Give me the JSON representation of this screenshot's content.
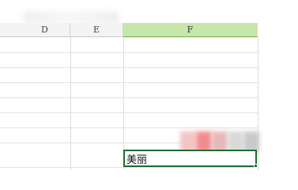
{
  "spreadsheet": {
    "column_headers": [
      {
        "label": "D",
        "state": "partial"
      },
      {
        "label": "E",
        "state": "normal"
      },
      {
        "label": "F",
        "state": "selected"
      }
    ],
    "active_cell": {
      "column": "F",
      "value": "美丽"
    }
  },
  "colors": {
    "selected_header_bg": "#c6e7a9",
    "active_cell_border": "#1e6b2e",
    "redaction_patch": [
      "#f2c4c4",
      "#f28c8c",
      "#e8b7b7",
      "#d9d9d9",
      "#c9c9c9"
    ]
  }
}
